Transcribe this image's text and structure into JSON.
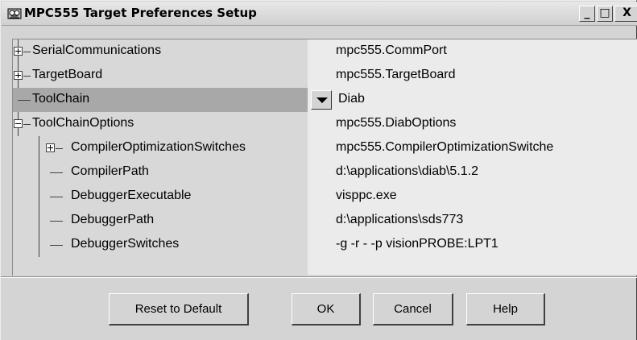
{
  "window": {
    "title": "MPC555 Target Preferences Setup",
    "minimize_label": "_",
    "maximize_label": "□",
    "close_label": "X"
  },
  "tree": {
    "rows": [
      {
        "name": "SerialCommunications",
        "value": "mpc555.CommPort",
        "expandable": true,
        "expanded": false,
        "level": 0
      },
      {
        "name": "TargetBoard",
        "value": "mpc555.TargetBoard",
        "expandable": true,
        "expanded": false,
        "level": 0
      },
      {
        "name": "ToolChain",
        "value": "Diab",
        "expandable": false,
        "selected": true,
        "level": 0
      },
      {
        "name": "ToolChainOptions",
        "value": "mpc555.DiabOptions",
        "expandable": true,
        "expanded": true,
        "level": 0
      },
      {
        "name": "CompilerOptimizationSwitches",
        "value": "mpc555.CompilerOptimizationSwitche",
        "expandable": true,
        "expanded": false,
        "level": 1
      },
      {
        "name": "CompilerPath",
        "value": "d:\\applications\\diab\\5.1.2",
        "expandable": false,
        "level": 1
      },
      {
        "name": "DebuggerExecutable",
        "value": "visppc.exe",
        "expandable": false,
        "level": 1
      },
      {
        "name": "DebuggerPath",
        "value": "d:\\applications\\sds773",
        "expandable": false,
        "level": 1
      },
      {
        "name": "DebuggerSwitches",
        "value": "-g -r - -p visionPROBE:LPT1",
        "expandable": false,
        "level": 1
      }
    ]
  },
  "buttons": {
    "reset": "Reset to Default",
    "ok": "OK",
    "cancel": "Cancel",
    "help": "Help"
  }
}
